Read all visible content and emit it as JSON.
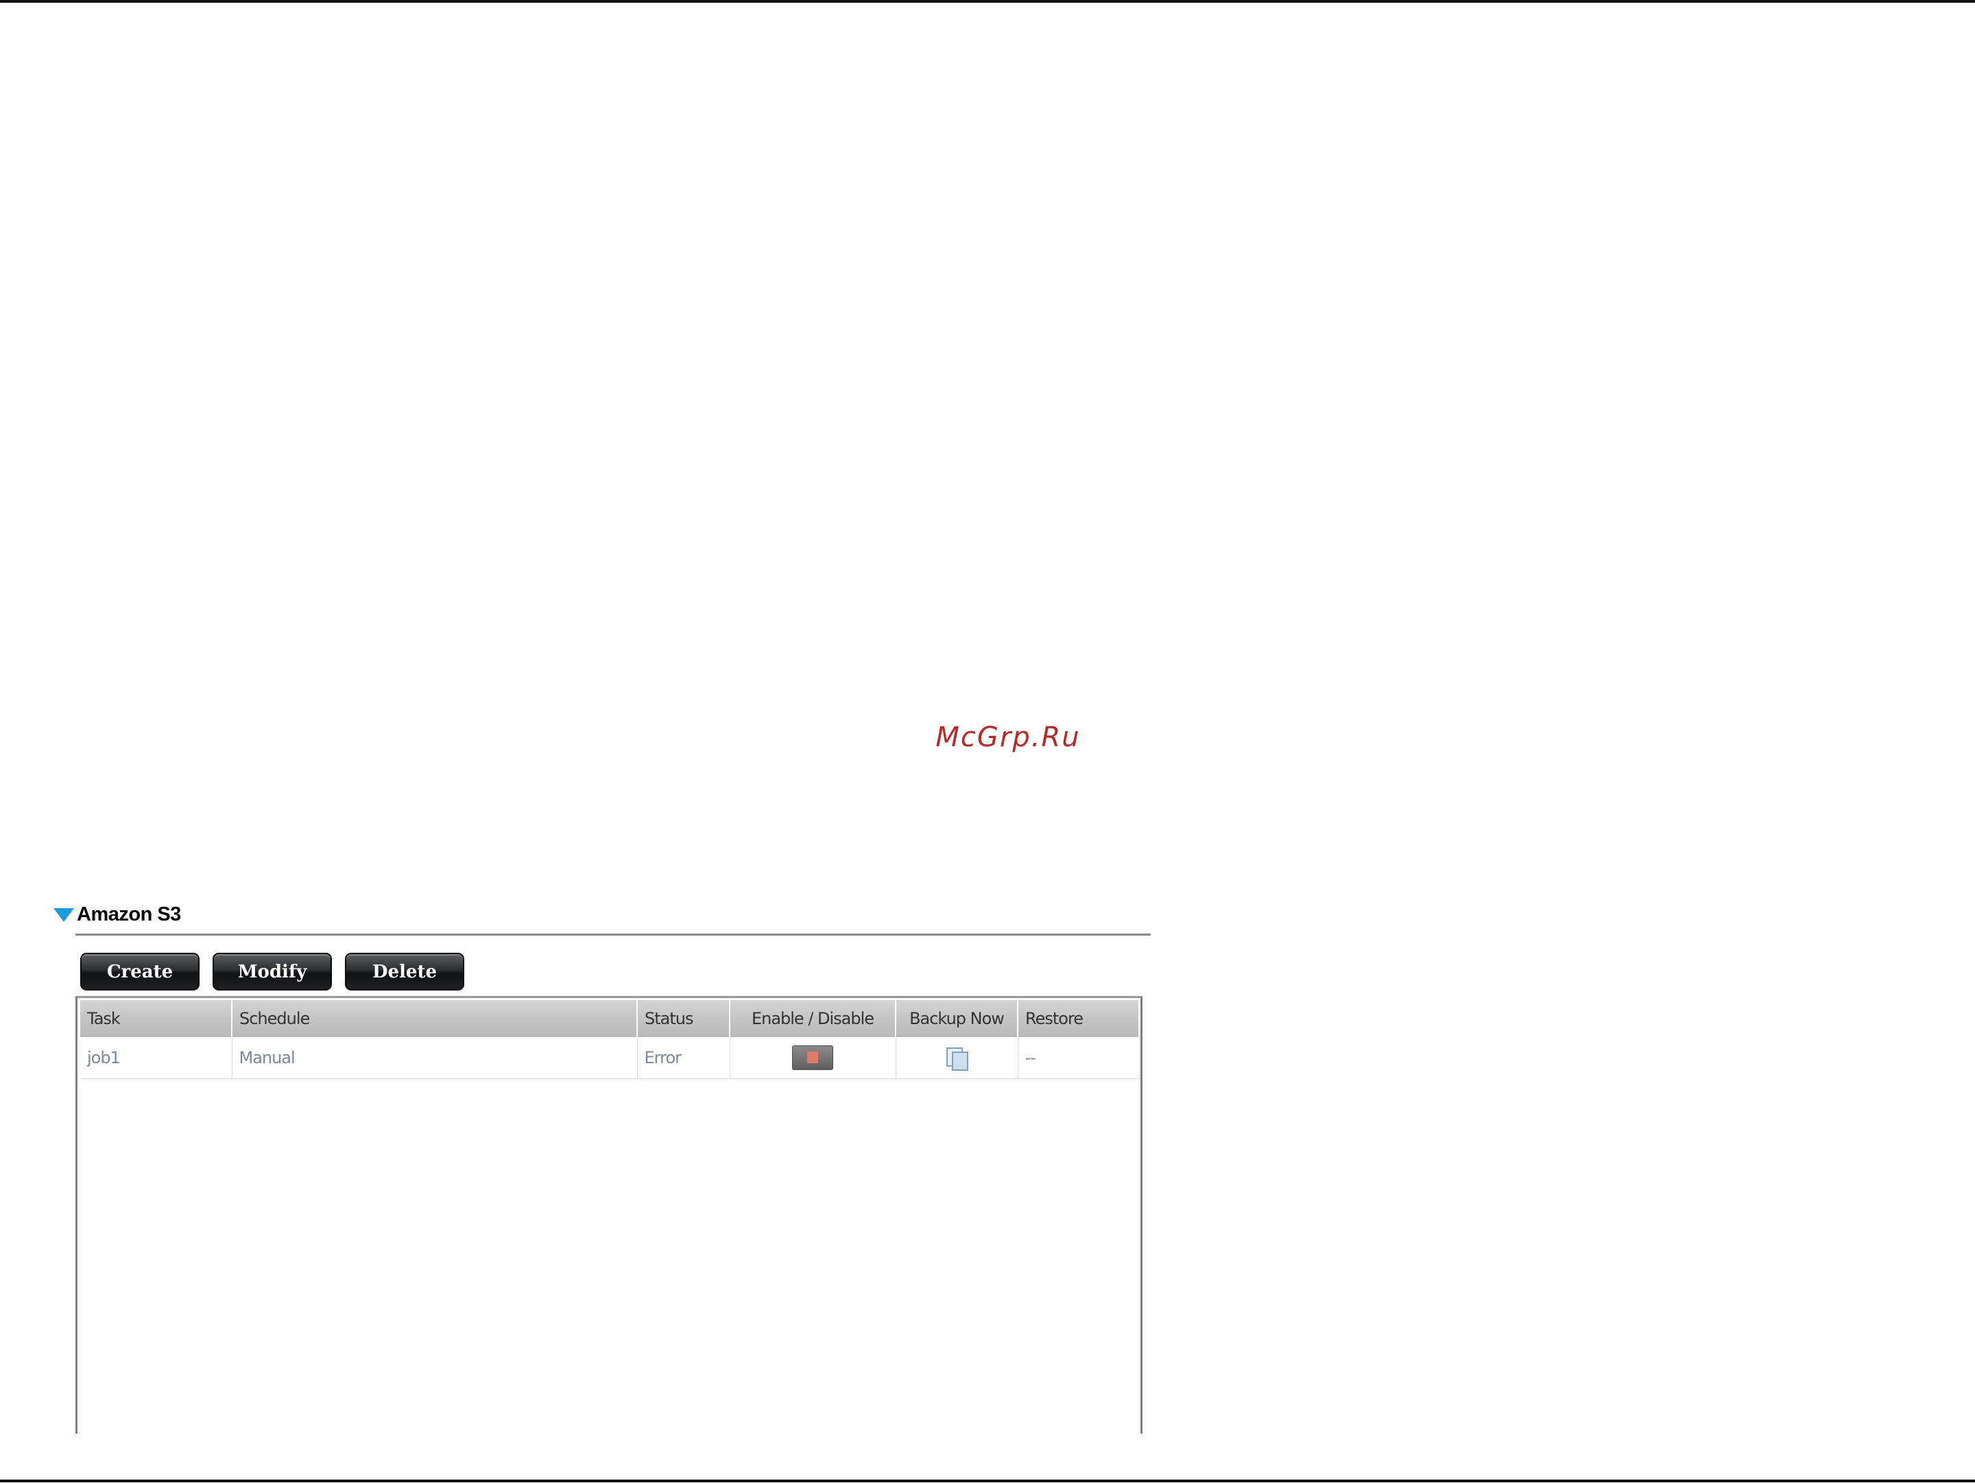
{
  "watermark": "McGrp.Ru",
  "section": {
    "title": "Amazon S3",
    "collapse_icon": "triangle-down-icon"
  },
  "toolbar": {
    "create_label": "Create",
    "modify_label": "Modify",
    "delete_label": "Delete"
  },
  "table": {
    "columns": [
      "Task",
      "Schedule",
      "Status",
      "Enable / Disable",
      "Backup Now",
      "Restore"
    ],
    "rows": [
      {
        "task": "job1",
        "schedule": "Manual",
        "status": "Error",
        "enable_icon": "toggle-switch-icon",
        "backup_icon": "backup-now-icon",
        "restore": "--"
      }
    ]
  },
  "colors": {
    "accent": "#1a9be0",
    "button_bg": "#1d1f22",
    "header_bg": "#c5c5c5",
    "toggle_indicator": "#e07a6a",
    "watermark": "#b52a2a"
  }
}
